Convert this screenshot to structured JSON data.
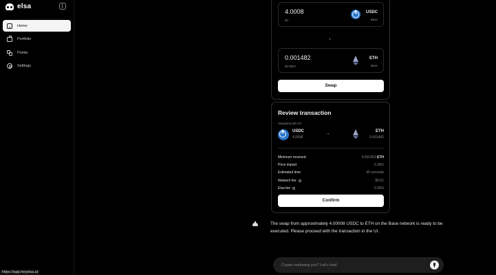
{
  "app": {
    "brand": "elsa"
  },
  "sidebar": {
    "items": [
      {
        "label": "Home",
        "icon": "home-icon",
        "active": true
      },
      {
        "label": "Portfolio",
        "icon": "briefcase-icon"
      },
      {
        "label": "Points",
        "icon": "points-icon"
      },
      {
        "label": "Settings",
        "icon": "gear-icon"
      }
    ]
  },
  "swap": {
    "from": {
      "amount": "4.0008",
      "usd": "$4",
      "token": "USDC",
      "chain": "Base",
      "icon": "usdc-icon"
    },
    "arrow": "↓",
    "to": {
      "amount": "0.001482",
      "usd": "$3.9557",
      "token": "ETH",
      "chain": "Base",
      "icon": "eth-icon"
    },
    "button": "Swap"
  },
  "review": {
    "title": "Review transaction",
    "subtitle": "Swapping with 0X",
    "from": {
      "token": "USDC",
      "amount": "4.0008"
    },
    "arrow": "→",
    "to": {
      "token": "ETH",
      "amount": "0.001482"
    },
    "rows": [
      {
        "label": "Minimum received",
        "value": "0.001453",
        "unit": "ETH"
      },
      {
        "label": "Price impact",
        "value": "0.36%"
      },
      {
        "label": "Estimated time",
        "value": "45 seconds"
      },
      {
        "label": "Network fee",
        "value": "$0.01"
      },
      {
        "label": "Elsa fee",
        "value": "0.35%"
      }
    ],
    "button": "Confirm"
  },
  "message": "The swap from approximately 4.00008 USDC to ETH on the Base network is ready to be executed. Please proceed with the transaction in the UI.",
  "chat": {
    "placeholder": "Crypto confusing you? Let's chat!"
  },
  "status_url": "https://app.heyelsa.ai",
  "colors": {
    "background": "#000000",
    "usdc": "#2775ca",
    "eth": "#9aa4c8",
    "button": "#ffffff"
  }
}
